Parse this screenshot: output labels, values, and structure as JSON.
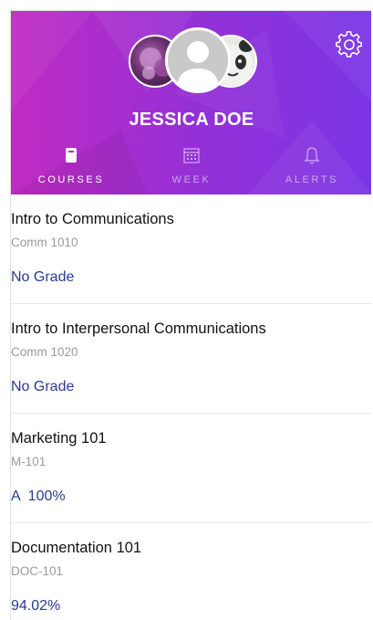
{
  "profile": {
    "name": "JESSICA DOE"
  },
  "tabs": [
    {
      "label": "COURSES",
      "icon": "book-icon",
      "active": true
    },
    {
      "label": "WEEK",
      "icon": "calendar-icon",
      "active": false
    },
    {
      "label": "ALERTS",
      "icon": "bell-icon",
      "active": false
    }
  ],
  "courses": [
    {
      "name": "Intro to Communications",
      "code": "Comm 1010",
      "grade": "No Grade"
    },
    {
      "name": "Intro to Interpersonal Communications",
      "code": "Comm 1020",
      "grade": "No Grade"
    },
    {
      "name": "Marketing 101",
      "code": "M-101",
      "grade": "A  100%"
    },
    {
      "name": "Documentation 101",
      "code": "DOC-101",
      "grade": "94.02%"
    }
  ],
  "colors": {
    "header_start": "#c02bc2",
    "header_end": "#7a35e6",
    "grade_text": "#2b3a8f"
  }
}
